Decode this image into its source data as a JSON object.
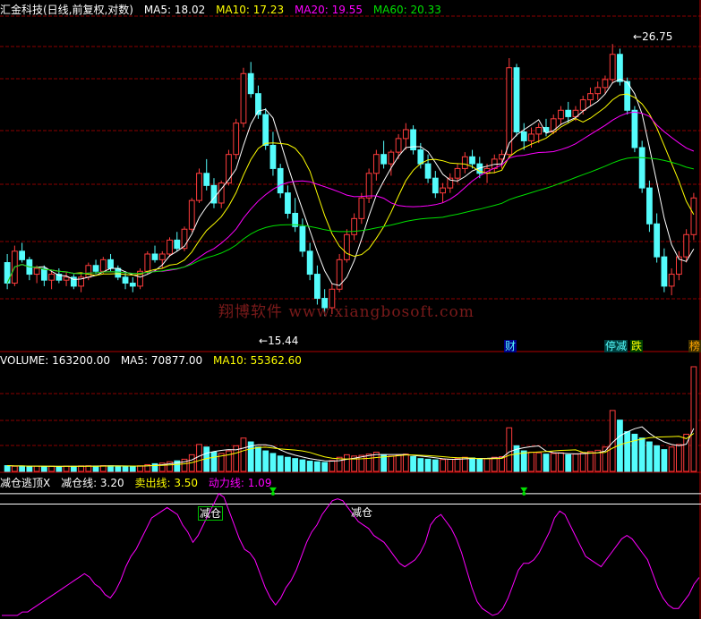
{
  "header": {
    "title": "汇金科技(日线,前复权,对数)",
    "ma5": "MA5: 18.02",
    "ma10": "MA10: 17.23",
    "ma20": "MA20: 19.55",
    "ma60": "MA60: 20.33"
  },
  "volume_header": {
    "volume": "VOLUME: 163200.00",
    "ma5": "MA5: 70877.00",
    "ma10": "MA10: 55362.60"
  },
  "indicator_header": {
    "name": "减仓逃顶X",
    "line1": "减仓线: 3.20",
    "line2": "卖出线: 3.50",
    "line3": "动力线: 1.09"
  },
  "price_labels": {
    "high": "26.75",
    "low": "15.44"
  },
  "event_tags": {
    "cai": "财",
    "tingjian": "停减",
    "die": "跌",
    "bang": "榜"
  },
  "signals": {
    "s1": "减仓",
    "s2": "减仓"
  },
  "watermark": "翔博软件 www.xiangbosoft.com",
  "colors": {
    "up": "#ff3c3c",
    "down": "#54fcfc",
    "ma5": "#ffffff",
    "ma10": "#ffff00",
    "ma20": "#ff00ff",
    "ma60": "#00e000",
    "grid": "#8b0000",
    "power": "#ff00ff"
  },
  "chart_data": [
    {
      "type": "candlestick",
      "title": "汇金科技(日线,前复权,对数)",
      "annotations": [
        "26.75",
        "15.44"
      ],
      "ylim": [
        14.5,
        28
      ],
      "log_scale": true,
      "candles": [
        [
          17.2,
          17.5,
          16.3,
          16.5
        ],
        [
          16.5,
          17.8,
          16.4,
          17.6
        ],
        [
          17.6,
          17.9,
          17.2,
          17.3
        ],
        [
          17.3,
          17.4,
          16.6,
          16.8
        ],
        [
          16.8,
          17.1,
          16.5,
          17.0
        ],
        [
          17.0,
          17.1,
          16.4,
          16.6
        ],
        [
          16.6,
          16.9,
          16.3,
          16.8
        ],
        [
          16.8,
          17.0,
          16.5,
          16.6
        ],
        [
          16.6,
          16.9,
          16.4,
          16.7
        ],
        [
          16.7,
          16.8,
          16.3,
          16.4
        ],
        [
          16.4,
          16.8,
          16.2,
          16.7
        ],
        [
          16.7,
          17.2,
          16.6,
          17.1
        ],
        [
          17.1,
          17.3,
          16.8,
          16.9
        ],
        [
          16.9,
          17.4,
          16.8,
          17.3
        ],
        [
          17.3,
          17.5,
          16.9,
          17.0
        ],
        [
          17.0,
          17.1,
          16.6,
          16.7
        ],
        [
          16.7,
          16.9,
          16.3,
          16.5
        ],
        [
          16.5,
          16.7,
          16.2,
          16.4
        ],
        [
          16.4,
          17.0,
          16.3,
          16.9
        ],
        [
          16.9,
          17.6,
          16.8,
          17.5
        ],
        [
          17.5,
          17.8,
          17.2,
          17.3
        ],
        [
          17.3,
          17.6,
          17.0,
          17.5
        ],
        [
          17.5,
          18.1,
          17.4,
          18.0
        ],
        [
          18.0,
          18.3,
          17.6,
          17.7
        ],
        [
          17.7,
          18.5,
          17.6,
          18.4
        ],
        [
          18.4,
          19.6,
          18.3,
          19.5
        ],
        [
          19.5,
          20.8,
          19.4,
          20.6
        ],
        [
          20.6,
          21.2,
          19.9,
          20.1
        ],
        [
          20.1,
          20.4,
          19.2,
          19.4
        ],
        [
          19.4,
          20.3,
          19.2,
          20.2
        ],
        [
          20.2,
          21.6,
          20.1,
          21.4
        ],
        [
          21.4,
          23.0,
          21.2,
          22.8
        ],
        [
          22.8,
          25.5,
          22.6,
          25.2
        ],
        [
          25.2,
          25.8,
          24.0,
          24.2
        ],
        [
          24.2,
          24.6,
          23.0,
          23.2
        ],
        [
          23.2,
          23.5,
          21.6,
          21.8
        ],
        [
          21.8,
          22.4,
          20.5,
          20.8
        ],
        [
          20.8,
          21.0,
          19.6,
          19.8
        ],
        [
          19.8,
          20.1,
          18.8,
          19.0
        ],
        [
          19.0,
          19.6,
          18.3,
          18.5
        ],
        [
          18.5,
          18.8,
          17.4,
          17.6
        ],
        [
          17.6,
          17.9,
          16.6,
          16.8
        ],
        [
          16.8,
          17.1,
          15.8,
          16.0
        ],
        [
          16.0,
          16.3,
          15.44,
          15.7
        ],
        [
          15.7,
          16.5,
          15.5,
          16.3
        ],
        [
          16.3,
          17.5,
          16.2,
          17.3
        ],
        [
          17.3,
          18.4,
          17.2,
          18.2
        ],
        [
          18.2,
          19.0,
          18.0,
          18.8
        ],
        [
          18.8,
          19.8,
          18.6,
          19.6
        ],
        [
          19.6,
          20.8,
          19.4,
          20.6
        ],
        [
          20.6,
          21.6,
          20.3,
          21.4
        ],
        [
          21.4,
          22.0,
          20.8,
          21.0
        ],
        [
          21.0,
          21.6,
          20.5,
          21.5
        ],
        [
          21.5,
          22.3,
          21.2,
          22.1
        ],
        [
          22.1,
          22.8,
          21.6,
          22.5
        ],
        [
          22.5,
          22.7,
          21.4,
          21.6
        ],
        [
          21.6,
          21.9,
          20.8,
          21.0
        ],
        [
          21.0,
          21.4,
          20.2,
          20.4
        ],
        [
          20.4,
          20.7,
          19.6,
          19.8
        ],
        [
          19.8,
          20.2,
          19.4,
          20.0
        ],
        [
          20.0,
          20.6,
          19.8,
          20.4
        ],
        [
          20.4,
          21.0,
          20.2,
          20.8
        ],
        [
          20.8,
          21.5,
          20.6,
          21.3
        ],
        [
          21.3,
          21.6,
          20.8,
          21.0
        ],
        [
          21.0,
          21.3,
          20.4,
          20.6
        ],
        [
          20.6,
          21.0,
          20.2,
          20.8
        ],
        [
          20.8,
          21.4,
          20.6,
          21.2
        ],
        [
          21.2,
          21.6,
          20.8,
          21.4
        ],
        [
          21.4,
          26.0,
          21.3,
          25.5
        ],
        [
          25.5,
          25.7,
          22.2,
          22.4
        ],
        [
          22.4,
          22.8,
          21.6,
          22.0
        ],
        [
          22.0,
          22.6,
          21.7,
          22.3
        ],
        [
          22.3,
          22.8,
          21.9,
          22.6
        ],
        [
          22.6,
          23.0,
          22.2,
          22.4
        ],
        [
          22.4,
          23.2,
          22.3,
          23.0
        ],
        [
          23.0,
          23.6,
          22.7,
          23.4
        ],
        [
          23.4,
          23.8,
          22.8,
          23.1
        ],
        [
          23.1,
          23.6,
          22.9,
          23.4
        ],
        [
          23.4,
          24.1,
          23.2,
          23.9
        ],
        [
          23.9,
          24.5,
          23.6,
          24.2
        ],
        [
          24.2,
          24.8,
          23.9,
          24.5
        ],
        [
          24.5,
          25.1,
          24.2,
          24.9
        ],
        [
          24.9,
          26.75,
          24.7,
          26.2
        ],
        [
          26.2,
          26.5,
          24.6,
          24.8
        ],
        [
          24.8,
          25.0,
          23.2,
          23.4
        ],
        [
          23.4,
          23.6,
          21.5,
          21.7
        ],
        [
          21.7,
          22.0,
          19.8,
          20.0
        ],
        [
          20.0,
          20.3,
          18.3,
          18.6
        ],
        [
          18.6,
          19.0,
          17.2,
          17.4
        ],
        [
          17.4,
          17.7,
          16.2,
          16.4
        ],
        [
          16.4,
          17.0,
          16.1,
          16.8
        ],
        [
          16.8,
          17.6,
          16.6,
          17.4
        ],
        [
          17.4,
          18.4,
          17.2,
          18.2
        ],
        [
          18.2,
          19.8,
          18.0,
          19.6
        ]
      ],
      "ma_values": {
        "MA5": 18.02,
        "MA10": 17.23,
        "MA20": 19.55,
        "MA60": 20.33
      }
    },
    {
      "type": "bar",
      "title": "VOLUME",
      "series": [
        {
          "name": "VOLUME",
          "last": 163200.0
        },
        {
          "name": "MA5",
          "last": 70877.0
        },
        {
          "name": "MA10",
          "last": 55362.6
        }
      ],
      "volumes": [
        9000,
        8000,
        8500,
        7500,
        8200,
        7800,
        8100,
        7600,
        8300,
        7900,
        8600,
        8800,
        8400,
        9000,
        8700,
        8200,
        8000,
        7700,
        8800,
        10500,
        12000,
        13000,
        15000,
        16500,
        19000,
        26000,
        42000,
        38000,
        30000,
        28000,
        32000,
        40000,
        52000,
        46000,
        38000,
        32000,
        28000,
        24000,
        22000,
        20000,
        18000,
        16000,
        15000,
        14000,
        17000,
        22000,
        26000,
        24000,
        25000,
        27000,
        30000,
        26000,
        24000,
        25000,
        27000,
        23000,
        20000,
        19000,
        18000,
        18500,
        19000,
        20000,
        22000,
        21000,
        19000,
        20000,
        22000,
        23000,
        68000,
        40000,
        32000,
        30000,
        29000,
        27000,
        28000,
        29000,
        26000,
        27000,
        29000,
        31000,
        33000,
        38000,
        95000,
        80000,
        62000,
        58000,
        52000,
        46000,
        40000,
        34000,
        38000,
        42000,
        58000,
        163200
      ]
    },
    {
      "type": "line",
      "title": "减仓逃顶X",
      "series": [
        {
          "name": "减仓线",
          "value": 3.2
        },
        {
          "name": "卖出线",
          "value": 3.5
        },
        {
          "name": "动力线",
          "last": 1.09,
          "values": [
            0.0,
            0.0,
            0.0,
            0.0,
            0.1,
            0.1,
            0.2,
            0.3,
            0.4,
            0.5,
            0.6,
            0.7,
            0.8,
            0.9,
            1.0,
            1.1,
            1.2,
            1.1,
            0.9,
            0.8,
            0.6,
            0.5,
            0.7,
            1.0,
            1.4,
            1.7,
            1.9,
            2.2,
            2.5,
            2.8,
            2.9,
            3.0,
            3.1,
            3.0,
            2.9,
            2.6,
            2.4,
            2.1,
            2.3,
            2.6,
            2.9,
            3.2,
            3.5,
            3.4,
            3.0,
            2.6,
            2.2,
            1.9,
            1.8,
            1.6,
            1.2,
            0.8,
            0.5,
            0.3,
            0.5,
            0.8,
            1.0,
            1.3,
            1.7,
            2.1,
            2.4,
            2.6,
            2.9,
            3.1,
            3.3,
            3.35,
            3.3,
            3.1,
            2.9,
            2.7,
            2.6,
            2.5,
            2.3,
            2.2,
            2.1,
            1.9,
            1.7,
            1.5,
            1.4,
            1.5,
            1.6,
            1.8,
            2.1,
            2.6,
            2.8,
            2.9,
            2.7,
            2.5,
            2.2,
            1.8,
            1.3,
            0.8,
            0.4,
            0.2,
            0.1,
            0.0,
            0.05,
            0.2,
            0.5,
            0.9,
            1.3,
            1.5,
            1.5,
            1.6,
            1.8,
            2.1,
            2.4,
            2.8,
            3.0,
            2.9,
            2.6,
            2.3,
            2.0,
            1.7,
            1.6,
            1.5,
            1.4,
            1.6,
            1.8,
            2.0,
            2.2,
            2.3,
            2.2,
            2.0,
            1.8,
            1.6,
            1.2,
            0.8,
            0.5,
            0.3,
            0.2,
            0.2,
            0.4,
            0.6,
            0.9,
            1.09
          ]
        }
      ],
      "signals_at": [
        36,
        70
      ]
    }
  ]
}
